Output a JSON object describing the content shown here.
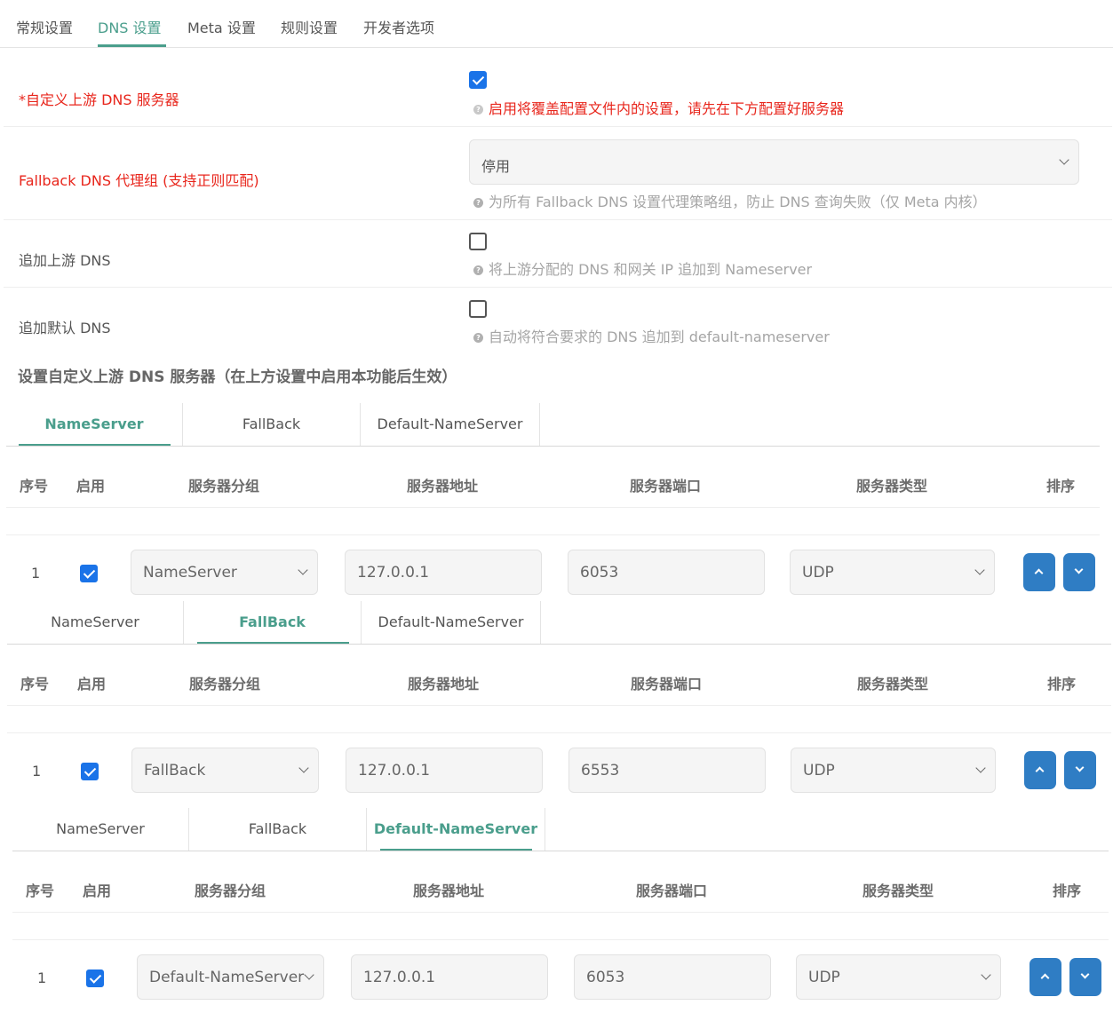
{
  "nav": {
    "tabs": [
      {
        "label": "常规设置"
      },
      {
        "label": "DNS 设置"
      },
      {
        "label": "Meta 设置"
      },
      {
        "label": "规则设置"
      },
      {
        "label": "开发者选项"
      }
    ],
    "active_index": 1
  },
  "settings": {
    "custom_upstream": {
      "label": "*自定义上游 DNS 服务器",
      "checked": true,
      "hint": "启用将覆盖配置文件内的设置，请先在下方配置好服务器"
    },
    "fallback_group": {
      "label": "Fallback DNS 代理组 (支持正则匹配)",
      "value": "停用",
      "hint": "为所有 Fallback DNS 设置代理策略组，防止 DNS 查询失败（仅 Meta 内核）"
    },
    "append_upstream": {
      "label": "追加上游 DNS",
      "checked": false,
      "hint": "将上游分配的 DNS 和网关 IP 追加到 Nameserver"
    },
    "append_default": {
      "label": "追加默认 DNS",
      "checked": false,
      "hint": "自动将符合要求的 DNS 追加到 default-nameserver"
    }
  },
  "section_title": "设置自定义上游 DNS 服务器（在上方设置中启用本功能后生效）",
  "table_headers": [
    "序号",
    "启用",
    "服务器分组",
    "服务器地址",
    "服务器端口",
    "服务器类型",
    "排序"
  ],
  "panels": [
    {
      "tabs": [
        "NameServer",
        "FallBack",
        "Default-NameServer"
      ],
      "active_tab": 0,
      "row": {
        "index": "1",
        "enabled": true,
        "group": "NameServer",
        "address": "127.0.0.1",
        "port": "6053",
        "type": "UDP"
      }
    },
    {
      "tabs": [
        "NameServer",
        "FallBack",
        "Default-NameServer"
      ],
      "active_tab": 1,
      "row": {
        "index": "1",
        "enabled": true,
        "group": "FallBack",
        "address": "127.0.0.1",
        "port": "6553",
        "type": "UDP"
      }
    },
    {
      "tabs": [
        "NameServer",
        "FallBack",
        "Default-NameServer"
      ],
      "active_tab": 2,
      "row": {
        "index": "1",
        "enabled": true,
        "group": "Default-NameServer",
        "address": "127.0.0.1",
        "port": "6053",
        "type": "UDP"
      }
    }
  ],
  "colors": {
    "accent": "#4a9e8c",
    "required": "#e8261c",
    "button": "#2f7dc4",
    "checkbox": "#1a73e8"
  }
}
